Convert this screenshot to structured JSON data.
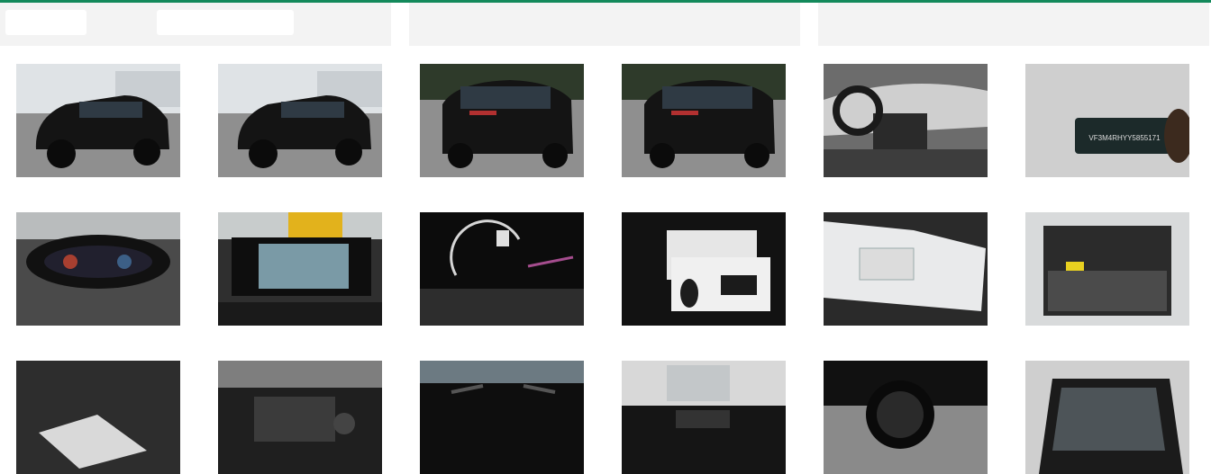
{
  "theme": {
    "accent": "#13895b",
    "header_bg": "#f3f3f3"
  },
  "gallery": {
    "columns": [
      {
        "header_controls": [
          "filter-pill",
          "search-pill"
        ],
        "photos": [
          {
            "subject": "car-front-three-quarter",
            "tone": "exterior"
          },
          {
            "subject": "car-front-three-quarter",
            "tone": "exterior"
          },
          {
            "subject": "car-front-three-quarter",
            "tone": "exterior"
          },
          {
            "subject": "car-front-three-quarter",
            "tone": "exterior"
          },
          {
            "subject": "car-front-three-quarter",
            "tone": "exterior"
          },
          {
            "subject": "car-front-three-quarter",
            "tone": "exterior"
          }
        ]
      },
      {
        "header_controls": [],
        "photos": []
      },
      {
        "header_controls": [],
        "photos": []
      }
    ],
    "rows": [
      [
        {
          "subject": "car-front-left",
          "tone": "exterior"
        },
        {
          "subject": "car-front-left",
          "tone": "exterior"
        },
        {
          "subject": "car-rear",
          "tone": "exterior"
        },
        {
          "subject": "car-rear",
          "tone": "exterior"
        },
        {
          "subject": "interior-dashboard",
          "tone": "interior"
        },
        {
          "subject": "vin-plate",
          "tone": "detail"
        }
      ],
      [
        {
          "subject": "instrument-cluster",
          "tone": "interior"
        },
        {
          "subject": "infotainment-screen",
          "tone": "interior"
        },
        {
          "subject": "digital-cockpit",
          "tone": "interior"
        },
        {
          "subject": "manuals-and-keys",
          "tone": "detail"
        },
        {
          "subject": "registration-document",
          "tone": "detail"
        },
        {
          "subject": "trunk",
          "tone": "interior"
        }
      ],
      [
        {
          "subject": "trunk-floor",
          "tone": "interior"
        },
        {
          "subject": "engine-bay",
          "tone": "detail"
        },
        {
          "subject": "roof",
          "tone": "exterior"
        },
        {
          "subject": "roof-panorama",
          "tone": "exterior"
        },
        {
          "subject": "wheel",
          "tone": "exterior"
        },
        {
          "subject": "windshield",
          "tone": "exterior"
        }
      ]
    ],
    "vin_text": "VF3M4RHYY5855171"
  }
}
